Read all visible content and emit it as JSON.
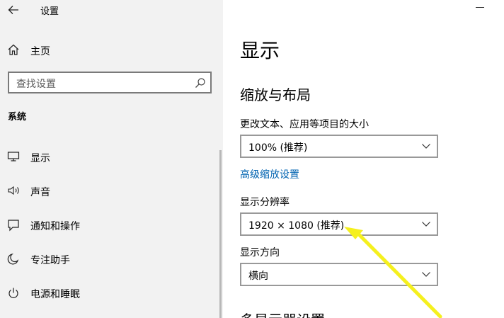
{
  "window": {
    "title": "设置"
  },
  "sidebar": {
    "home_label": "主页",
    "search_placeholder": "查找设置",
    "section_label": "系统",
    "items": [
      {
        "label": "显示",
        "icon": "monitor-icon"
      },
      {
        "label": "声音",
        "icon": "speaker-icon"
      },
      {
        "label": "通知和操作",
        "icon": "notification-icon"
      },
      {
        "label": "专注助手",
        "icon": "moon-icon"
      },
      {
        "label": "电源和睡眠",
        "icon": "power-icon"
      }
    ]
  },
  "main": {
    "page_title": "显示",
    "section_title": "缩放与布局",
    "scale": {
      "label": "更改文本、应用等项目的大小",
      "value": "100% (推荐)"
    },
    "advanced_link": "高级缩放设置",
    "resolution": {
      "label": "显示分辨率",
      "value": "1920 × 1080 (推荐)"
    },
    "orientation": {
      "label": "显示方向",
      "value": "横向"
    },
    "next_section_title": "多显示器设置"
  },
  "colors": {
    "link": "#0063b1",
    "annotation_arrow": "#f5f01e",
    "sidebar_bg": "#f2f2f2"
  }
}
